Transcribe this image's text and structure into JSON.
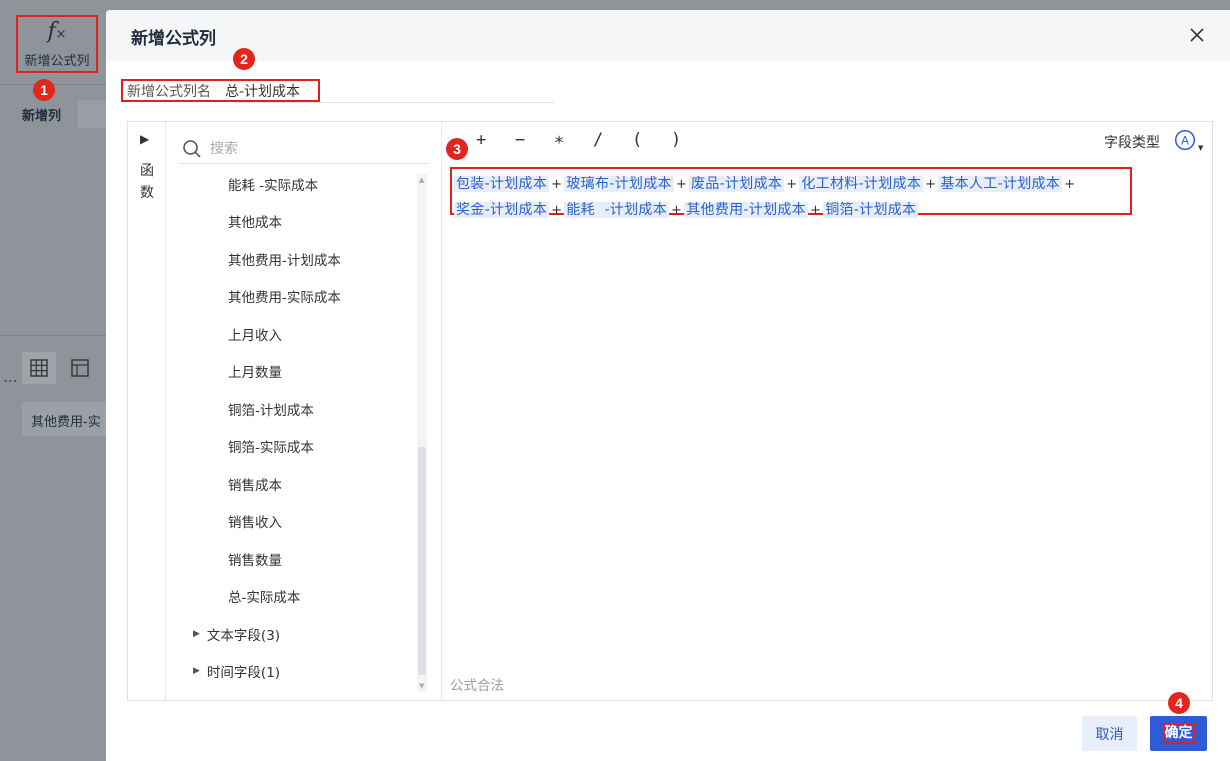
{
  "background": {
    "toolbar": {
      "add_formula_label": "新增公式列"
    },
    "new_column_label": "新增列",
    "field_chip": "其他费用-实"
  },
  "badges": [
    "1",
    "2",
    "3",
    "4"
  ],
  "dialog": {
    "title": "新增公式列",
    "name_label": "新增公式列名",
    "name_value": "总-计划成本",
    "function_tab": "函数",
    "search_placeholder": "搜索",
    "fields": [
      "能耗 -实际成本",
      "其他成本",
      "其他费用-计划成本",
      "其他费用-实际成本",
      "上月收入",
      "上月数量",
      "铜箔-计划成本",
      "铜箔-实际成本",
      "销售成本",
      "销售收入",
      "销售数量",
      "总-实际成本"
    ],
    "groups": [
      "文本字段(3)",
      "时间字段(1)"
    ],
    "operators": [
      "+",
      "−",
      "∗",
      "/",
      "(",
      ")"
    ],
    "field_type_label": "字段类型",
    "formula_line1": [
      "包装-计划成本",
      "玻璃布-计划成本",
      "废品-计划成本",
      "化工材料-计划成本",
      "基本人工-计划成本"
    ],
    "formula_line2": [
      "奖金-计划成本",
      "能耗  -计划成本",
      "其他费用-计划成本",
      "铜箔-计划成本"
    ],
    "operator_plus": "+",
    "validation": "公式合法",
    "cancel_label": "取消",
    "ok_label": "确定"
  },
  "colors": {
    "accent": "#2f5bd8",
    "highlight": "#e02020",
    "badge": "#e3261d",
    "token_bg": "#e8eef9",
    "token_text": "#2a62c9"
  }
}
